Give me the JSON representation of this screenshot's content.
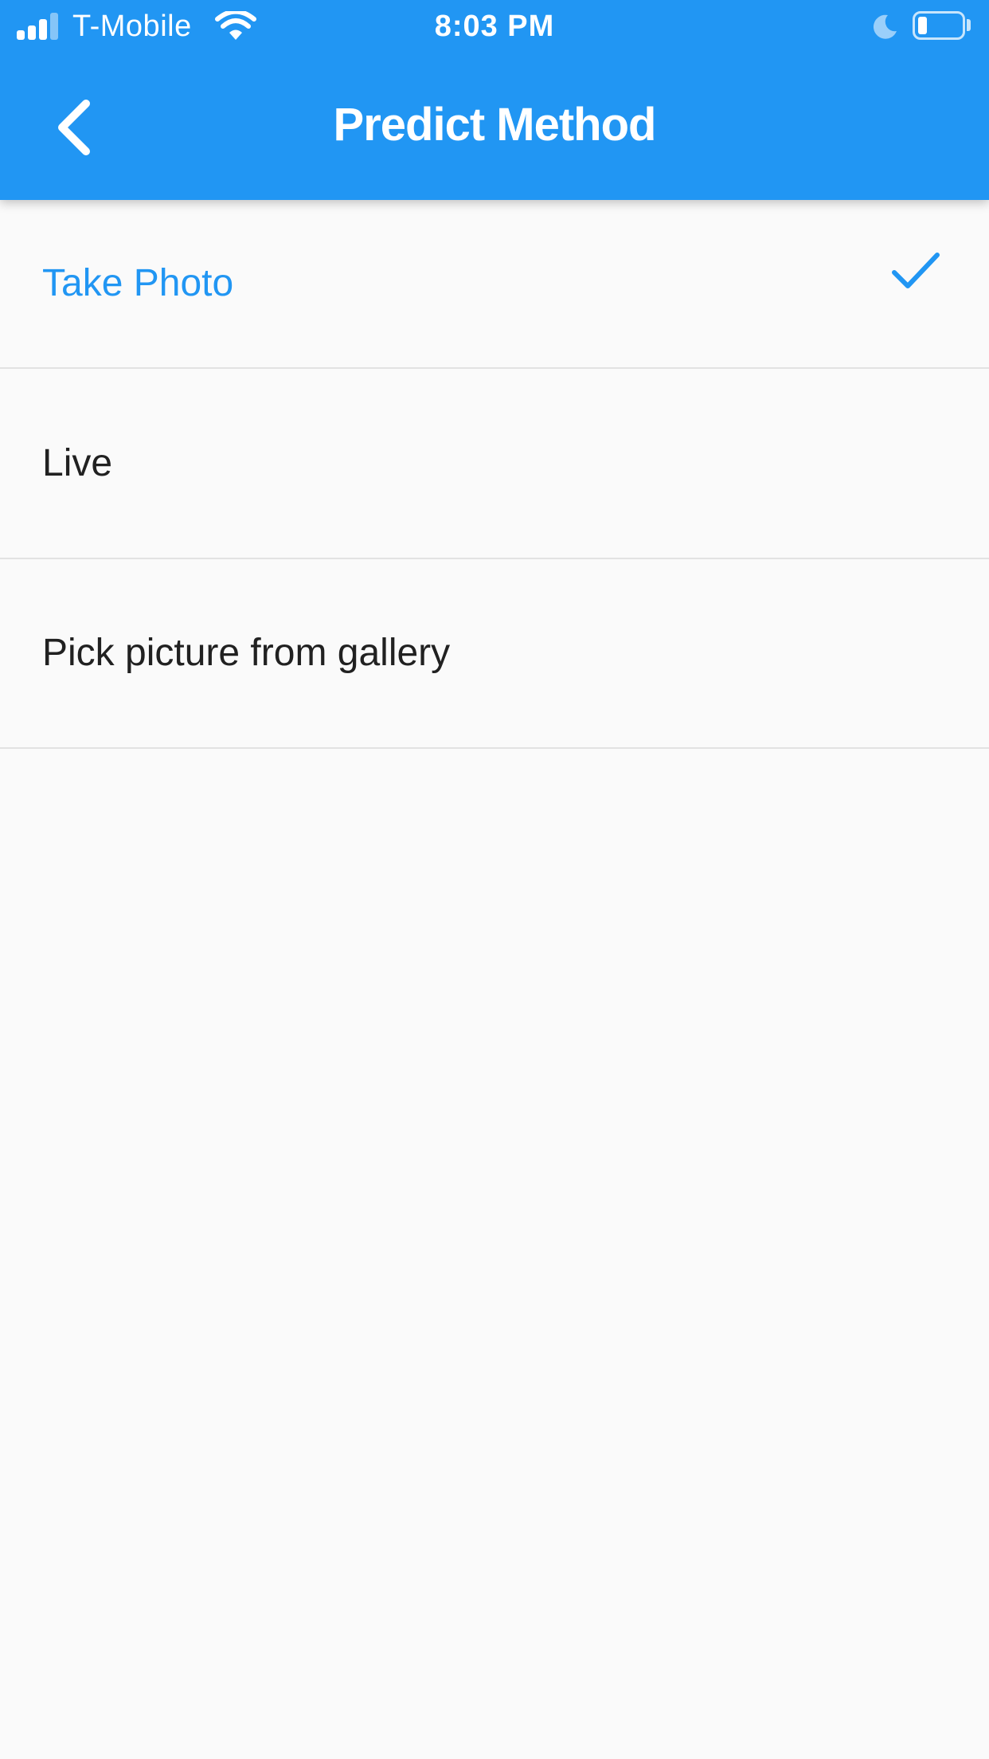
{
  "status_bar": {
    "carrier": "T-Mobile",
    "time": "8:03 PM",
    "battery_level": 0.2
  },
  "app_bar": {
    "title": "Predict Method",
    "back_icon": "chevron-left-icon",
    "color": "#2196f3"
  },
  "options": {
    "selected_index": 0,
    "items": [
      {
        "label": "Take Photo",
        "selected": true
      },
      {
        "label": "Live",
        "selected": false
      },
      {
        "label": "Pick picture from gallery",
        "selected": false
      }
    ]
  },
  "colors": {
    "accent": "#2196f3",
    "background": "#fafafa",
    "divider": "#e2e2e2",
    "text": "#212121"
  }
}
